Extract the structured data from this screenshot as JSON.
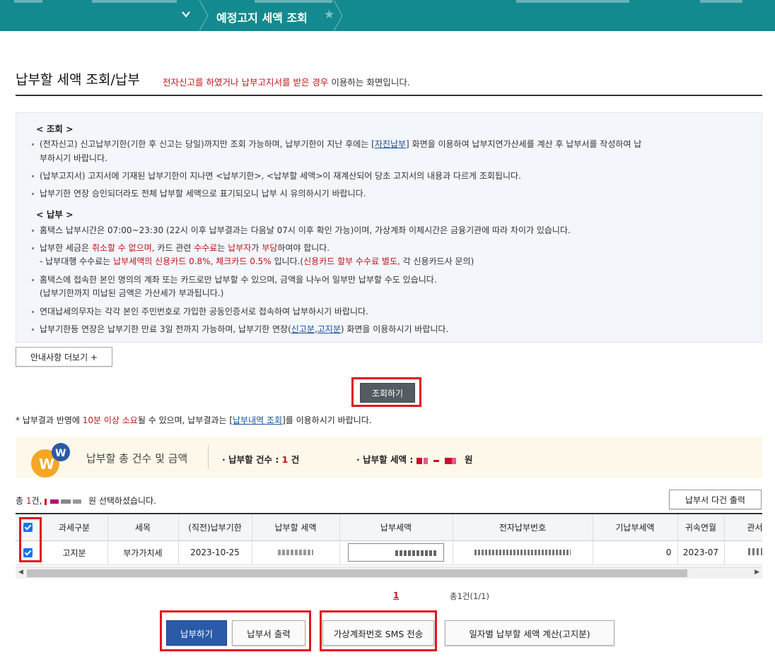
{
  "topbar": {
    "breadcrumb": "예정고지 세액 조회"
  },
  "heading": {
    "title": "납부할 세액 조회/납부",
    "note_red": "전자신고를 하였거나 납부고지서를 받은 경우",
    "note_rest": " 이용하는 화면입니다."
  },
  "info": {
    "section1": "< 조회 >",
    "l1a": "(전자신고) 신고납부기한(기한 후 신고는 당일)까지만 조회 가능하며, 납부기한이 지난 후에는 [",
    "l1link": "자진납부",
    "l1b": "] 화면을 이용하여 납부지연가산세를 계산 후 납부서를 작성하여 납",
    "l1c": "부하시기 바랍니다.",
    "l2": "(납부고지서) 고지서에 기재된 납부기한이 지나면 <납부기한>, <납부할 세액>이 재계산되어 당초 고지서의 내용과 다르게 조회됩니다.",
    "l3": "납부기한 연장 승인되더라도 전체 납부할 세액으로 표기되오니 납부 시 유의하시기 바랍니다.",
    "section2": "< 납부 >",
    "l4": "홈택스 납부시간은 07:00~23:30 (22시 이후 납부결과는 다음날 07시 이후 확인 가능)이며, 가상계좌 이체시간은 금융기관에 따라 차이가 있습니다.",
    "l5a": "납부한 세금은 ",
    "l5red1": "취소할 수 없으며,",
    "l5b": " 카드 관련 ",
    "l5red2": "수수료",
    "l5c": "는 ",
    "l5red3": "납부자",
    "l5d": "가 ",
    "l5red4": "부담",
    "l5e": "하여야 합니다.",
    "l5sub_a": "- 납부대행 수수료는 ",
    "l5sub_red": "납부세액의 신용카드 0.8%, 체크카드 0.5%",
    "l5sub_b": " 입니다.(",
    "l5sub_red2": "신용카드 할부 수수료 별도,",
    "l5sub_c": " 각 신용카드사 문의)",
    "l6": "홈택스에 접속한 본인 명의의 계좌 또는 카드로만 납부할 수 있으며, 금액을 나누어 일부만 납부할 수도 있습니다.",
    "l6sub": "(납부기한까지 미납된 금액은 가산세가 부과됩니다.)",
    "l7": "연대납세의무자는 각각 본인 주민번호로 가입한 공동인증서로 접속하여 납부하시기 바랍니다.",
    "l8a": "납부기한등 연장은 납부기한 만료 3일 전까지 가능하며, 납부기한 연장(",
    "l8link1": "신고분",
    "l8comma": ",",
    "l8link2": "고지분",
    "l8b": ") 화면을 이용하시기 바랍니다."
  },
  "more_button": "안내사항 더보기 +",
  "inquiry_button": "조회하기",
  "notice": {
    "a": "* 납부결과 반영에 ",
    "red": "10분 이상 소요",
    "b": "될 수 있으며, 납부결과는 [",
    "link": "납부내역 조회",
    "c": "]를 이용하시기 바랍니다."
  },
  "summary": {
    "title": "납부할 총 건수 및 금액",
    "count_label": "납부할 건수 : ",
    "count_value": "1",
    "count_unit": " 건",
    "amount_label": "납부할 세액 : ",
    "amount_unit": "원"
  },
  "total": {
    "a": "총 ",
    "count": "1",
    "b": "건, ",
    "c": " 원 선택하셨습니다."
  },
  "multi_print_button": "납부서 다건 출력",
  "table": {
    "headers": [
      "과세구분",
      "세목",
      "(직전)납부기한",
      "납부할 세액",
      "납부세액",
      "전자납부번호",
      "기납부세액",
      "귀속연월",
      "관서명"
    ],
    "row": {
      "type": "고지분",
      "item": "부가가치세",
      "due": "2023-10-25",
      "paid": "0",
      "period": "2023-07"
    }
  },
  "pager": {
    "page": "1",
    "total": "총1건(1/1)"
  },
  "buttons": {
    "pay": "납부하기",
    "print": "납부서 출력",
    "sms": "가상계좌번호 SMS 전송",
    "daily_calc": "일자별 납부할 세액 계산(고지분)"
  },
  "colors": {
    "teal": "#138a8f",
    "red": "#c0141b",
    "primary": "#2a5aa8"
  }
}
